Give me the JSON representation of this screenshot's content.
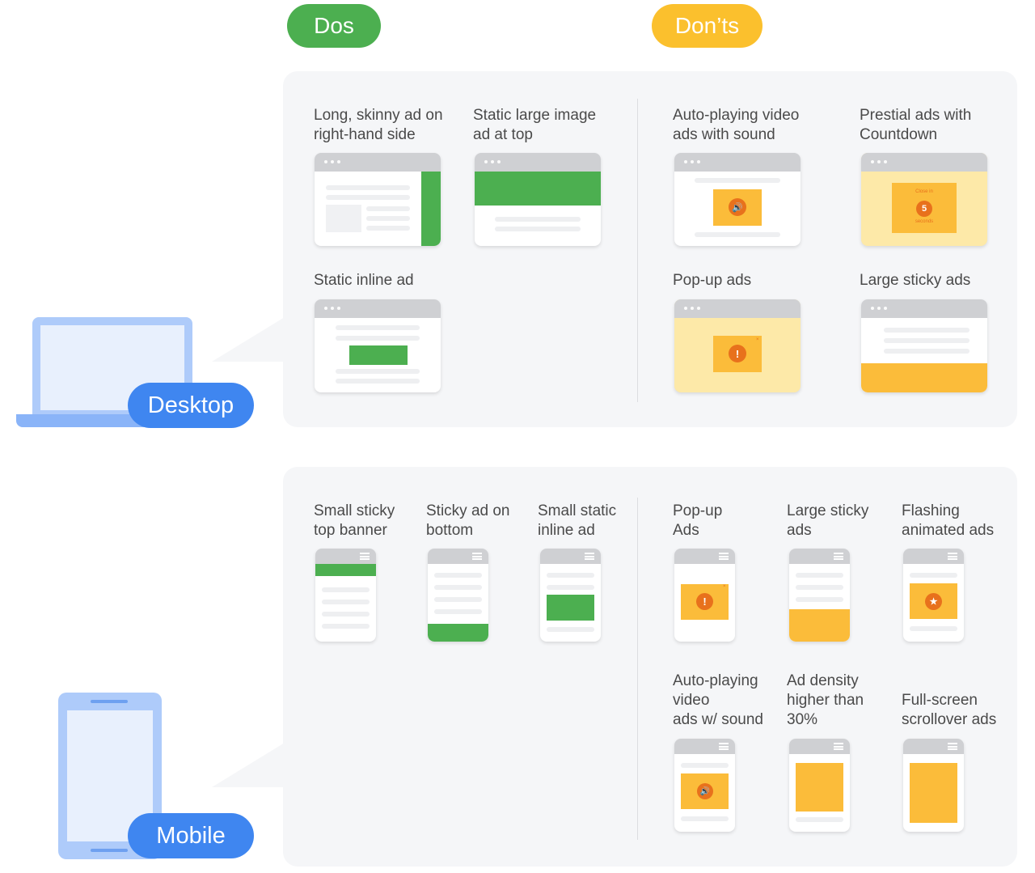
{
  "headers": {
    "dos": "Dos",
    "donts": "Don’ts"
  },
  "devices": {
    "desktop": "Desktop",
    "mobile": "Mobile"
  },
  "colors": {
    "dos": "#4caf50",
    "donts": "#fbc02d",
    "device": "#3f86f0",
    "ad_yellow": "#fbbc3a",
    "alert_orange": "#e8711c"
  },
  "desktop": {
    "dos": [
      {
        "label": "Long, skinny ad on\nright-hand side",
        "icon": "browser-right-sidebar-ad"
      },
      {
        "label": "Static large image\nad at top",
        "icon": "browser-top-banner-ad"
      },
      {
        "label": "Static inline ad",
        "icon": "browser-inline-ad"
      }
    ],
    "donts": [
      {
        "label": "Auto-playing video\nads with sound",
        "icon": "browser-sound-ad"
      },
      {
        "label": "Prestial ads with\nCountdown",
        "icon": "browser-countdown-ad",
        "countdown": {
          "top": "Close in",
          "number": "5",
          "bottom": "seconds"
        }
      },
      {
        "label": "Pop-up ads",
        "icon": "browser-popup-ad"
      },
      {
        "label": "Large sticky ads",
        "icon": "browser-large-sticky-ad"
      }
    ]
  },
  "mobile": {
    "dos": [
      {
        "label": "Small sticky\ntop banner",
        "icon": "phone-top-banner-ad"
      },
      {
        "label": "Sticky ad on\nbottom",
        "icon": "phone-bottom-sticky-ad"
      },
      {
        "label": "Small static\ninline ad",
        "icon": "phone-inline-ad"
      }
    ],
    "donts": [
      {
        "label": "Pop-up\nAds",
        "icon": "phone-popup-ad"
      },
      {
        "label": "Large sticky\nads",
        "icon": "phone-large-sticky-ad"
      },
      {
        "label": "Flashing\nanimated ads",
        "icon": "phone-flashing-ad"
      },
      {
        "label": "Auto-playing\nvideo\nads w/ sound",
        "icon": "phone-sound-ad"
      },
      {
        "label": "Ad density\nhigher than\n30%",
        "icon": "phone-dense-ad"
      },
      {
        "label": "Full-screen\nscrollover ads",
        "icon": "phone-fullscreen-ad"
      }
    ]
  }
}
